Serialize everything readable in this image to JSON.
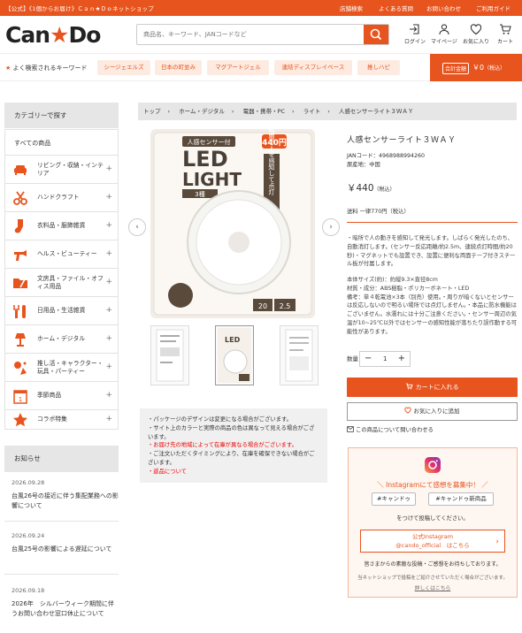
{
  "topbar": {
    "label": "【公式】《1個からお届け》Ｃａｎ★Ｄｏネットショップ",
    "links": [
      "店舗検索",
      "よくある質問",
      "お問い合わせ",
      "ご利用ガイド"
    ]
  },
  "header": {
    "logo_text": "Can",
    "logo_star": "★",
    "logo_text2": "Do",
    "search_placeholder": "商品名、キーワード、JANコードなど",
    "icons": [
      "ログイン",
      "マイページ",
      "お気に入り",
      "カート"
    ]
  },
  "keywords": {
    "label": "よく検索されるキーワード",
    "items": [
      "シージェエルズ",
      "日本の町並み",
      "マグアートジェル",
      "連結ディスプレイベース",
      "推しハピ"
    ]
  },
  "cart": {
    "label": "合計金額",
    "amount": "￥0",
    "tax": "（税込）"
  },
  "sidebar": {
    "header": "カテゴリーで探す",
    "all": "すべての商品",
    "categories": [
      "リビング・収納・インテリア",
      "ハンドクラフト",
      "衣料品・服飾雑貨",
      "ヘルス・ビューティー",
      "文房具・ファイル・オフィス用品",
      "日用品・生活雑貨",
      "ホーム・デジタル",
      "推し活・キャラクター・玩具・パーティー",
      "季節商品",
      "コラボ特集"
    ],
    "news_header": "お知らせ",
    "news": [
      {
        "date": "2026.09.28",
        "text": "台風26号の接近に伴う集配業務への影響について"
      },
      {
        "date": "2026.09.24",
        "text": "台風25号の影響による遅延について"
      },
      {
        "date": "2026.09.18",
        "text": "2026年　シルバーウィーク期間に伴うお問い合わせ窓口休止について"
      }
    ]
  },
  "breadcrumb": [
    "トップ",
    "ホーム・デジタル",
    "電器・携帯・PC",
    "ライト",
    "人感センサーライト３ＷＡＹ"
  ],
  "product": {
    "title": "人感センサーライト３ＷＡＹ",
    "jan": "JANコード：4968988994260",
    "origin": "原産地：中国",
    "price": "￥440",
    "price_tax": "（税込）",
    "shipping": "送料 一律770円（税込）",
    "desc1": "・暗所で人の動きを感知して発光します。しばらく発光したのち、自動消灯します。(センサー反応距離/約2.5m、連続点灯時間/約20秒)・マグネットでも設置でき、設置に便利な両面テープ付きスチール板が付属します。",
    "desc2": "本体サイズ(約)：約縦9.3×直径8cm",
    "desc3": "材質・成分：ABS樹脂・ポリカーボネート・LED",
    "desc4": "備考：単４乾電池×3本（別売）使用。・周りが暗くないとセンサーは反応しないので明るい場所では点灯しません。・本品に防水機能はございません。水濡れには十分ご注意ください。・センサー周辺の気温が10~25℃以外ではセンサーの感知性能が落ちたり誤作動する可能性があります。",
    "qty_label": "数量",
    "qty": "1",
    "cart_button": "カートに入れる",
    "fav_button": "お気に入りに追加",
    "inquiry": "この商品について問い合わせる",
    "pkg_price": "440円",
    "pkg_title1": "LED",
    "pkg_title2": "LIGHT",
    "pkg_top": "人感センサー付",
    "pkg_side": "暗闇で人を感知して点灯",
    "pkg_mode": "3種",
    "pkg_20": "20",
    "pkg_25": "2.5"
  },
  "notes": [
    "・パッケージのデザインは変更になる場合がございます。",
    "・サイト上のカラーと実際の商品の色は異なって見える場合がございます。",
    "・お届け先の地域によって在庫が異なる場合がございます。",
    "・ご注文いただくタイミングにより、在庫を確保できない場合がございます。",
    "・返品について"
  ],
  "instagram": {
    "heading": "＼ Instagramにて感想を募集中！ ／",
    "tags": [
      "#キャンドゥ",
      "#キャンドゥ新商品"
    ],
    "sub": "をつけて投稿してください。",
    "btn1": "公式Instagram",
    "btn2": "@cando_official　はこちら",
    "note": "皆さまからの素敵な投稿・ご感想をお待ちしております。",
    "small": "当ネットショップで投稿をご紹介させていただく場合がございます。",
    "link": "詳しくはこちら"
  },
  "colors": {
    "accent": "#e8541e",
    "chip": "#fdebe2"
  }
}
